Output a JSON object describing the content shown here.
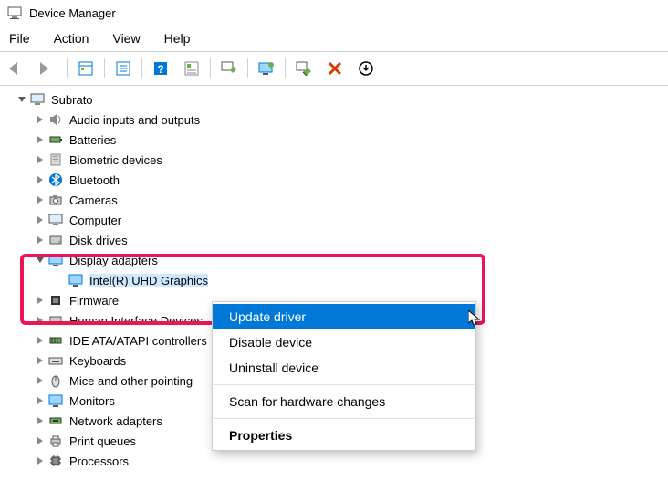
{
  "title": "Device Manager",
  "menu": {
    "file": "File",
    "action": "Action",
    "view": "View",
    "help": "Help"
  },
  "tree": {
    "root": "Subrato",
    "items": [
      {
        "label": "Audio inputs and outputs"
      },
      {
        "label": "Batteries"
      },
      {
        "label": "Biometric devices"
      },
      {
        "label": "Bluetooth"
      },
      {
        "label": "Cameras"
      },
      {
        "label": "Computer"
      },
      {
        "label": "Disk drives"
      },
      {
        "label": "Display adapters",
        "children": [
          {
            "label": "Intel(R) UHD Graphics"
          }
        ]
      },
      {
        "label": "Firmware"
      },
      {
        "label": "Human Interface Devices"
      },
      {
        "label": "IDE ATA/ATAPI controllers"
      },
      {
        "label": "Keyboards"
      },
      {
        "label": "Mice and other pointing"
      },
      {
        "label": "Monitors"
      },
      {
        "label": "Network adapters"
      },
      {
        "label": "Print queues"
      },
      {
        "label": "Processors"
      }
    ]
  },
  "context_menu": {
    "update": "Update driver",
    "disable": "Disable device",
    "uninstall": "Uninstall device",
    "scan": "Scan for hardware changes",
    "properties": "Properties"
  }
}
